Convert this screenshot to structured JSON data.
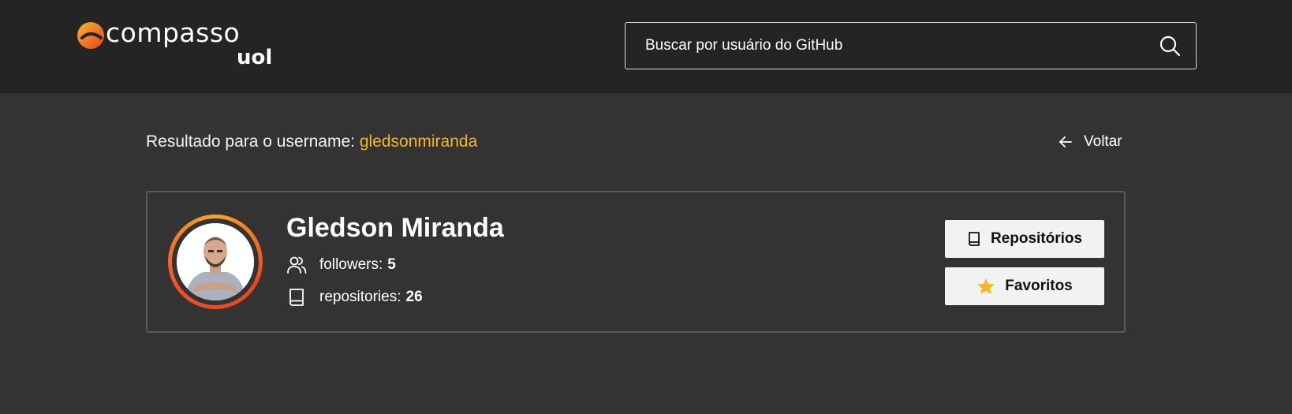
{
  "brand": {
    "name": "compasso",
    "sub": "uol",
    "accent_color": "#f5a623",
    "accent_color_2": "#e8441f"
  },
  "search": {
    "placeholder": "Buscar por usuário do GitHub",
    "icon": "search-icon"
  },
  "result": {
    "prefix": "Resultado para o username: ",
    "username": "gledsonmiranda",
    "username_color": "#f6b626"
  },
  "back": {
    "label": "Voltar",
    "icon": "arrow-left-icon"
  },
  "profile": {
    "name": "Gledson Miranda",
    "followers_label": "followers:",
    "followers_value": "5",
    "repositories_label": "repositories:",
    "repositories_value": "26",
    "followers_icon": "users-icon",
    "repositories_icon": "book-icon"
  },
  "actions": {
    "repos_label": "Repositórios",
    "repos_icon": "book-icon",
    "favs_label": "Favoritos",
    "favs_icon": "star-icon",
    "star_color": "#f6b626"
  }
}
